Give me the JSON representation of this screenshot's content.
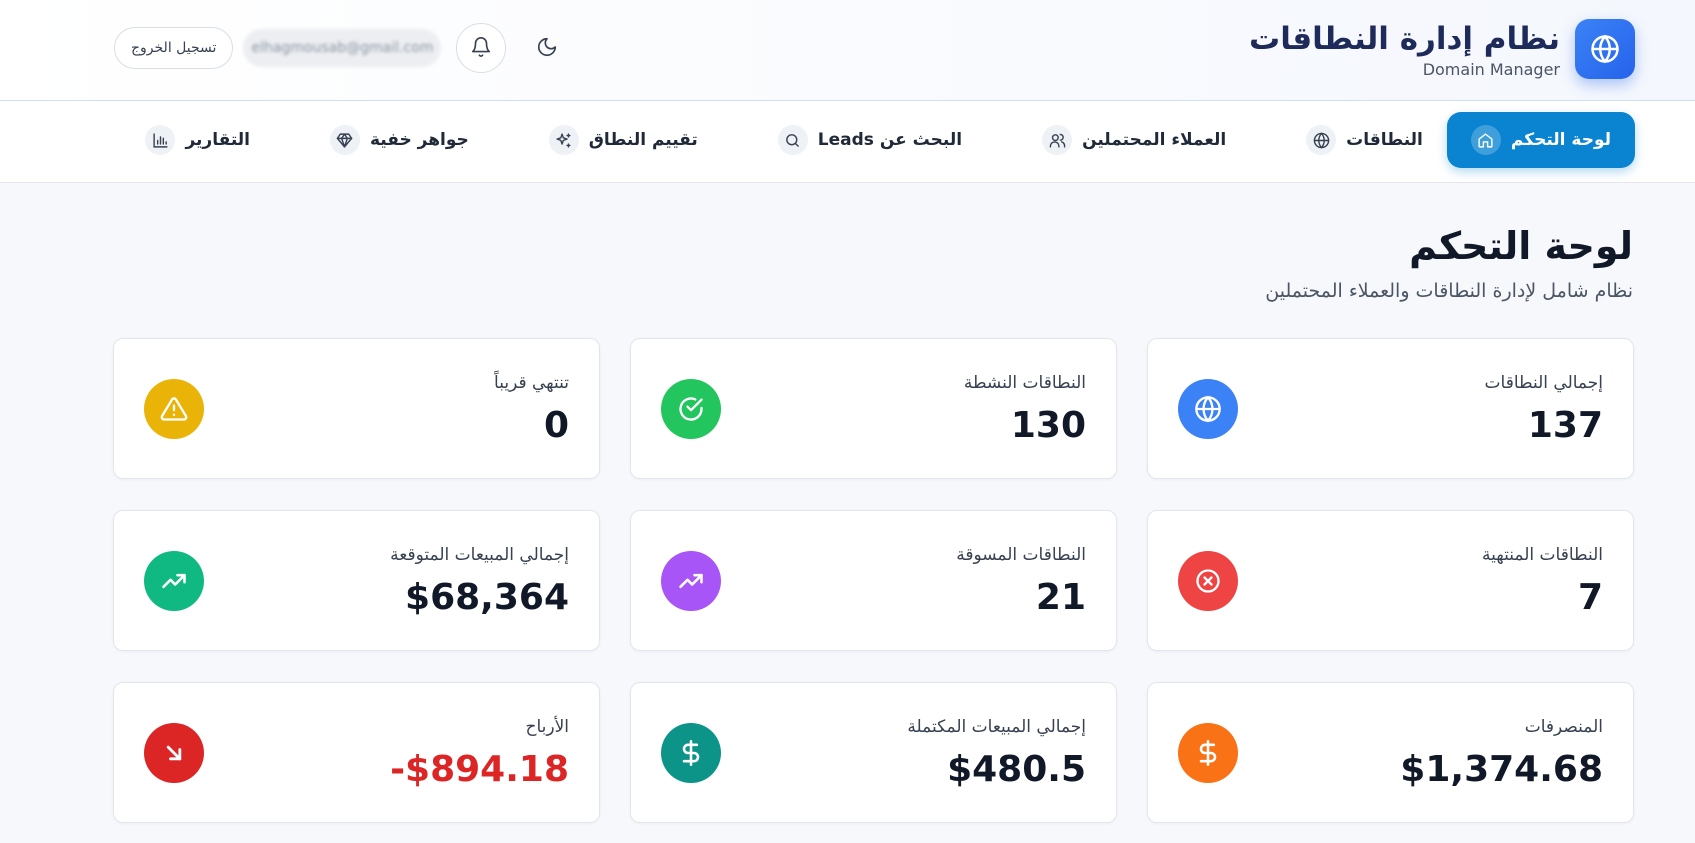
{
  "brand": {
    "title": "نظام إدارة النطاقات",
    "subtitle": "Domain Manager",
    "logo_icon": "globe-icon",
    "logo_color": "#2563eb"
  },
  "header": {
    "logout_label": "تسجيل الخروج",
    "email": "elhagmousab@gmail.com",
    "notifications_icon": "bell-icon",
    "theme_icon": "moon-icon"
  },
  "nav": {
    "items": [
      {
        "label": "لوحة التحكم",
        "icon": "home-icon",
        "active": true
      },
      {
        "label": "النطاقات",
        "icon": "globe-icon",
        "active": false
      },
      {
        "label": "العملاء المحتملين",
        "icon": "users-icon",
        "active": false
      },
      {
        "label": "البحث عن Leads",
        "icon": "search-icon",
        "active": false
      },
      {
        "label": "تقييم النطاق",
        "icon": "sparkles-icon",
        "active": false
      },
      {
        "label": "جواهر خفية",
        "icon": "gem-icon",
        "active": false
      },
      {
        "label": "التقارير",
        "icon": "bar-chart-icon",
        "active": false
      }
    ],
    "active_color": "#0a84d0"
  },
  "page": {
    "title": "لوحة التحكم",
    "subtitle": "نظام شامل لإدارة النطاقات والعملاء المحتملين"
  },
  "stats": [
    {
      "label": "إجمالي النطاقات",
      "value": "137",
      "icon": "globe-icon",
      "color": "#3b82f6"
    },
    {
      "label": "النطاقات النشطة",
      "value": "130",
      "icon": "check-circle-icon",
      "color": "#22c55e"
    },
    {
      "label": "تنتهي قريباً",
      "value": "0",
      "icon": "warning-icon",
      "color": "#eab308"
    },
    {
      "label": "النطاقات المنتهية",
      "value": "7",
      "icon": "x-circle-icon",
      "color": "#ef4444"
    },
    {
      "label": "النطاقات المسوقة",
      "value": "21",
      "icon": "trending-up-icon",
      "color": "#a855f7"
    },
    {
      "label": "إجمالي المبيعات المتوقعة",
      "value": "$68,364",
      "icon": "trending-up-icon",
      "color": "#10b981"
    },
    {
      "label": "المنصرفات",
      "value": "$1,374.68",
      "icon": "dollar-icon",
      "color": "#f97316"
    },
    {
      "label": "إجمالي المبيعات المكتملة",
      "value": "$480.5",
      "icon": "dollar-icon",
      "color": "#0d9488"
    },
    {
      "label": "الأرباح",
      "value": "-$894.18",
      "icon": "arrow-down-right-icon",
      "color": "#dc2626",
      "negative": true
    }
  ]
}
